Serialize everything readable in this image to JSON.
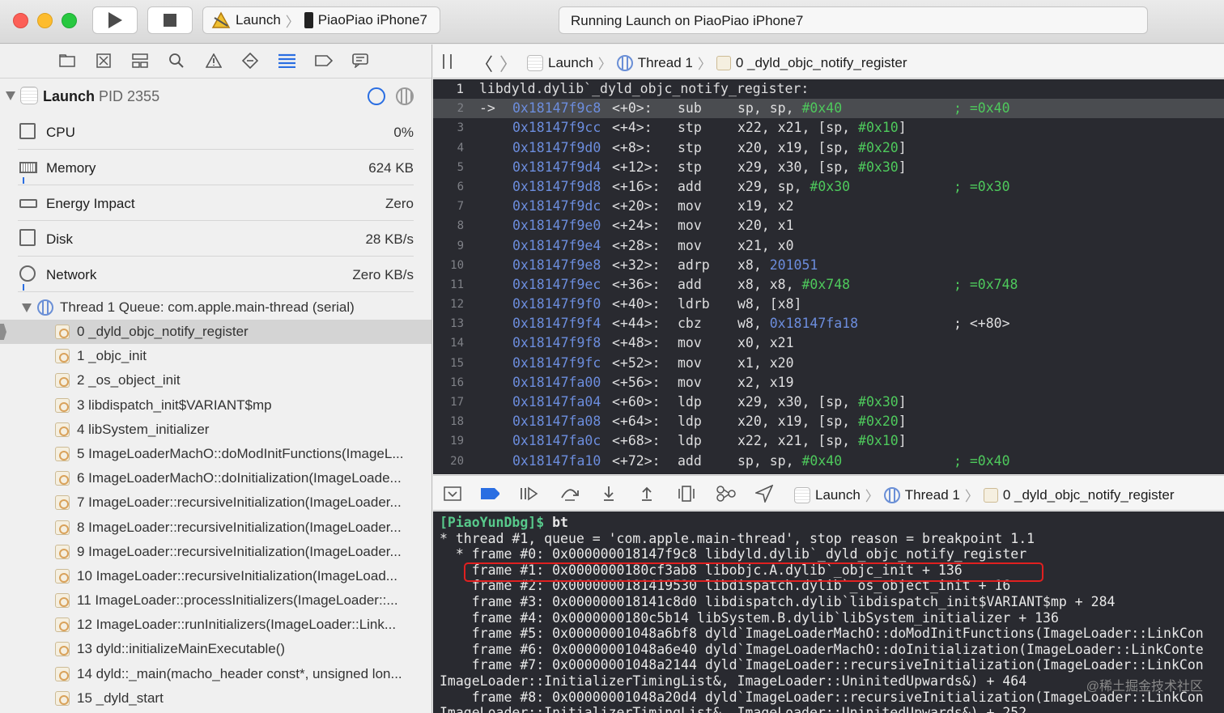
{
  "window": {
    "scheme": {
      "target": "Launch",
      "device": "PiaoPiao iPhone7"
    },
    "status": "Running Launch on PiaoPiao iPhone7"
  },
  "navigator": {
    "process": {
      "name": "Launch",
      "pid": "PID 2355"
    },
    "gauges": [
      {
        "label": "CPU",
        "value": "0%"
      },
      {
        "label": "Memory",
        "value": "624 KB"
      },
      {
        "label": "Energy Impact",
        "value": "Zero"
      },
      {
        "label": "Disk",
        "value": "28 KB/s"
      },
      {
        "label": "Network",
        "value": "Zero KB/s"
      }
    ],
    "thread": {
      "name": "Thread 1",
      "queue": "Queue: com.apple.main-thread (serial)"
    },
    "frames": [
      "0 _dyld_objc_notify_register",
      "1 _objc_init",
      "2 _os_object_init",
      "3 libdispatch_init$VARIANT$mp",
      "4 libSystem_initializer",
      "5 ImageLoaderMachO::doModInitFunctions(ImageL...",
      "6 ImageLoaderMachO::doInitialization(ImageLoade...",
      "7 ImageLoader::recursiveInitialization(ImageLoader...",
      "8 ImageLoader::recursiveInitialization(ImageLoader...",
      "9 ImageLoader::recursiveInitialization(ImageLoader...",
      "10 ImageLoader::recursiveInitialization(ImageLoad...",
      "11 ImageLoader::processInitializers(ImageLoader::...",
      "12 ImageLoader::runInitializers(ImageLoader::Link...",
      "13 dyld::initializeMainExecutable()",
      "14 dyld::_main(macho_header const*, unsigned lon...",
      "15 _dyld_start"
    ]
  },
  "editor": {
    "breadcrumb": [
      "Launch",
      "Thread 1",
      "0 _dyld_objc_notify_register"
    ],
    "header": "libdyld.dylib`_dyld_objc_notify_register:",
    "current_marker": "->",
    "lines": [
      {
        "addr": "0x18147f9c8",
        "off": "<+0>:",
        "op": "sub",
        "args": "sp, sp, ",
        "imm": "#0x40",
        "cmt": "; =0x40"
      },
      {
        "addr": "0x18147f9cc",
        "off": "<+4>:",
        "op": "stp",
        "args": "x22, x21, [sp, ",
        "imm": "#0x10",
        "tail": "]",
        "cmt": ""
      },
      {
        "addr": "0x18147f9d0",
        "off": "<+8>:",
        "op": "stp",
        "args": "x20, x19, [sp, ",
        "imm": "#0x20",
        "tail": "]",
        "cmt": ""
      },
      {
        "addr": "0x18147f9d4",
        "off": "<+12>:",
        "op": "stp",
        "args": "x29, x30, [sp, ",
        "imm": "#0x30",
        "tail": "]",
        "cmt": ""
      },
      {
        "addr": "0x18147f9d8",
        "off": "<+16>:",
        "op": "add",
        "args": "x29, sp, ",
        "imm": "#0x30",
        "cmt": "; =0x30"
      },
      {
        "addr": "0x18147f9dc",
        "off": "<+20>:",
        "op": "mov",
        "args": "x19, x2",
        "imm": "",
        "cmt": ""
      },
      {
        "addr": "0x18147f9e0",
        "off": "<+24>:",
        "op": "mov",
        "args": "x20, x1",
        "imm": "",
        "cmt": ""
      },
      {
        "addr": "0x18147f9e4",
        "off": "<+28>:",
        "op": "mov",
        "args": "x21, x0",
        "imm": "",
        "cmt": ""
      },
      {
        "addr": "0x18147f9e8",
        "off": "<+32>:",
        "op": "adrp",
        "args": "x8, ",
        "num": "201051",
        "imm": "",
        "cmt": ""
      },
      {
        "addr": "0x18147f9ec",
        "off": "<+36>:",
        "op": "add",
        "args": "x8, x8, ",
        "imm": "#0x748",
        "cmt": "; =0x748"
      },
      {
        "addr": "0x18147f9f0",
        "off": "<+40>:",
        "op": "ldrb",
        "args": "w8, [x8]",
        "imm": "",
        "cmt": ""
      },
      {
        "addr": "0x18147f9f4",
        "off": "<+44>:",
        "op": "cbz",
        "args": "w8, ",
        "num": "0x18147fa18",
        "imm": "",
        "cmt": "; <+80>"
      },
      {
        "addr": "0x18147f9f8",
        "off": "<+48>:",
        "op": "mov",
        "args": "x0, x21",
        "imm": "",
        "cmt": ""
      },
      {
        "addr": "0x18147f9fc",
        "off": "<+52>:",
        "op": "mov",
        "args": "x1, x20",
        "imm": "",
        "cmt": ""
      },
      {
        "addr": "0x18147fa00",
        "off": "<+56>:",
        "op": "mov",
        "args": "x2, x19",
        "imm": "",
        "cmt": ""
      },
      {
        "addr": "0x18147fa04",
        "off": "<+60>:",
        "op": "ldp",
        "args": "x29, x30, [sp, ",
        "imm": "#0x30",
        "tail": "]",
        "cmt": ""
      },
      {
        "addr": "0x18147fa08",
        "off": "<+64>:",
        "op": "ldp",
        "args": "x20, x19, [sp, ",
        "imm": "#0x20",
        "tail": "]",
        "cmt": ""
      },
      {
        "addr": "0x18147fa0c",
        "off": "<+68>:",
        "op": "ldp",
        "args": "x22, x21, [sp, ",
        "imm": "#0x10",
        "tail": "]",
        "cmt": ""
      },
      {
        "addr": "0x18147fa10",
        "off": "<+72>:",
        "op": "add",
        "args": "sp, sp, ",
        "imm": "#0x40",
        "cmt": "; =0x40"
      }
    ]
  },
  "debugbar": {
    "breadcrumb": [
      "Launch",
      "Thread 1",
      "0 _dyld_objc_notify_register"
    ]
  },
  "console": {
    "prompt": "[PiaoYunDbg]$",
    "command": "bt",
    "lines": [
      "* thread #1, queue = 'com.apple.main-thread', stop reason = breakpoint 1.1",
      "  * frame #0: 0x000000018147f9c8 libdyld.dylib`_dyld_objc_notify_register",
      "    frame #1: 0x0000000180cf3ab8 libobjc.A.dylib`_objc_init + 136",
      "    frame #2: 0x0000000181419530 libdispatch.dylib`_os_object_init + 16",
      "    frame #3: 0x000000018141c8d0 libdispatch.dylib`libdispatch_init$VARIANT$mp + 284",
      "    frame #4: 0x0000000180c5b14 libSystem.B.dylib`libSystem_initializer + 136",
      "    frame #5: 0x00000001048a6bf8 dyld`ImageLoaderMachO::doModInitFunctions(ImageLoader::LinkCon",
      "    frame #6: 0x00000001048a6e40 dyld`ImageLoaderMachO::doInitialization(ImageLoader::LinkConte",
      "    frame #7: 0x00000001048a2144 dyld`ImageLoader::recursiveInitialization(ImageLoader::LinkCon",
      "ImageLoader::InitializerTimingList&, ImageLoader::UninitedUpwards&) + 464",
      "    frame #8: 0x00000001048a20d4 dyld`ImageLoader::recursiveInitialization(ImageLoader::LinkCon",
      "ImageLoader::InitializerTimingList&, ImageLoader::UninitedUpwards&) + 252"
    ],
    "highlight_index": 2,
    "watermark": "@稀土掘金技术社区"
  },
  "colors": {
    "accent": "#2a6ee2",
    "highlight_box": "#e02020",
    "editor_bg": "#292a30"
  }
}
